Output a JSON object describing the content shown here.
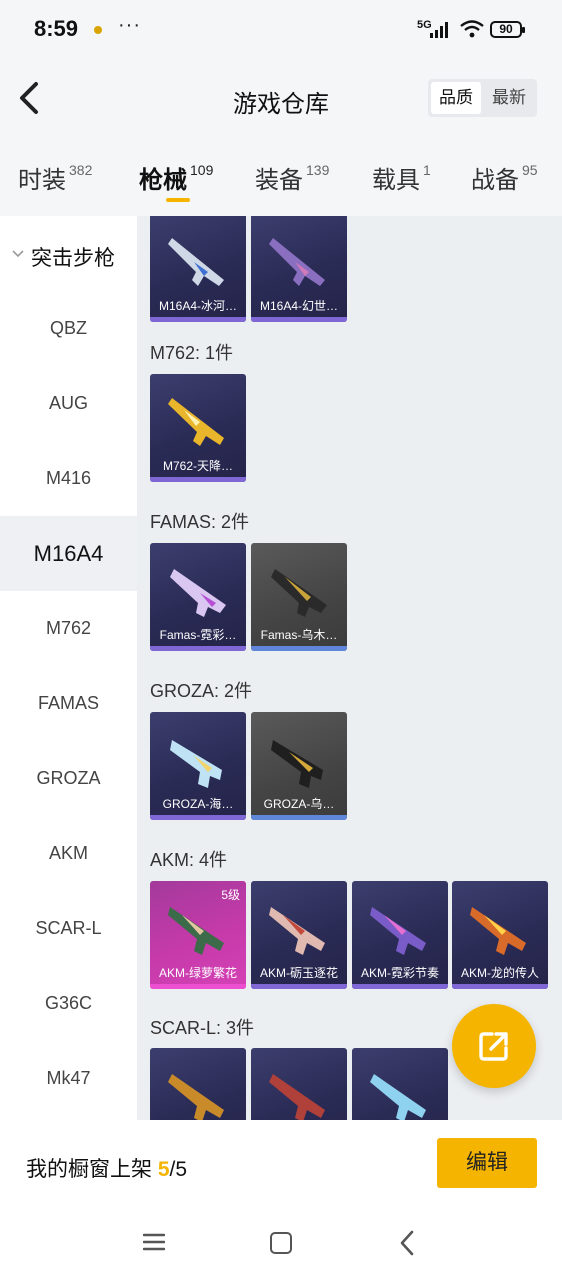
{
  "status_bar": {
    "time": "8:59",
    "dots": "···",
    "network": "5G",
    "battery": "90"
  },
  "header": {
    "title": "游戏仓库",
    "sort_options": [
      "品质",
      "最新"
    ]
  },
  "tabs": [
    {
      "label": "时装",
      "count": "382"
    },
    {
      "label": "枪械",
      "count": "109"
    },
    {
      "label": "装备",
      "count": "139"
    },
    {
      "label": "载具",
      "count": "1"
    },
    {
      "label": "战备",
      "count": "95"
    }
  ],
  "sidebar": {
    "group_label": "突击步枪",
    "items": [
      "QBZ",
      "AUG",
      "M416",
      "M16A4",
      "M762",
      "FAMAS",
      "GROZA",
      "AKM",
      "SCAR-L",
      "G36C",
      "Mk47"
    ]
  },
  "content": {
    "m16a4_cards": [
      "M16A4-冰河…",
      "M16A4-幻世…"
    ],
    "m762_title": "M762: 1件",
    "m762_cards": [
      "M762-天降…"
    ],
    "famas_title": "FAMAS: 2件",
    "famas_cards": [
      "Famas-霓彩…",
      "Famas-乌木…"
    ],
    "groza_title": "GROZA: 2件",
    "groza_cards": [
      "GROZA-海…",
      "GROZA-乌…"
    ],
    "akm_title": "AKM: 4件",
    "akm_cards": [
      "AKM-绿萝繁花",
      "AKM-砺玉逐花",
      "AKM-霓彩节奏",
      "AKM-龙的传人"
    ],
    "akm_level": "5级",
    "scar_title": "SCAR-L: 3件"
  },
  "bottom_bar": {
    "showcase_label": "我的橱窗上架",
    "showcase_used": "5",
    "showcase_total": "/5",
    "edit_label": "编辑"
  },
  "colors": {
    "accent": "#f5b400",
    "card_purple": "#2a2b55",
    "card_pink": "#c63aaa"
  }
}
